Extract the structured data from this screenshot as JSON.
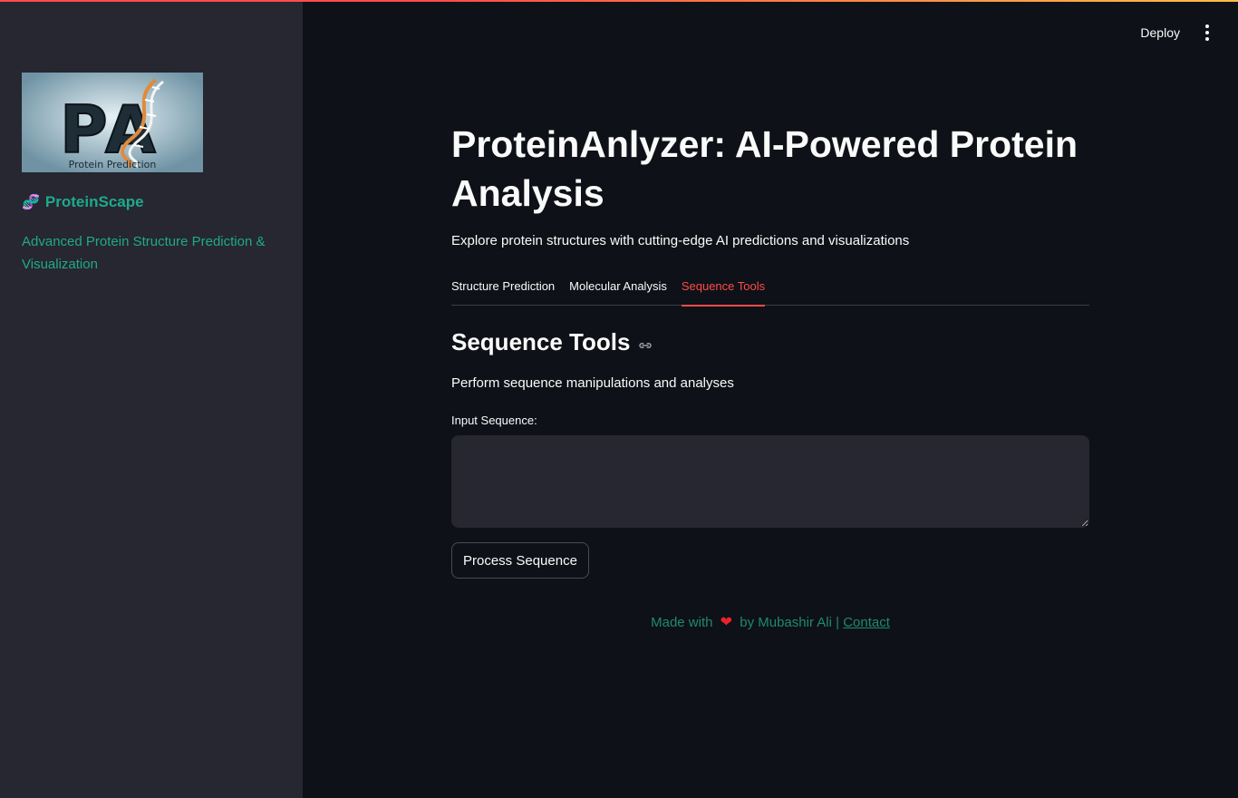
{
  "sidebar": {
    "logo": {
      "letters": "PA",
      "caption": "Protein Prediction"
    },
    "brand": {
      "icon": "dna-icon",
      "title": "ProteinScape"
    },
    "subtitle": "Advanced Protein Structure Prediction & Visualization"
  },
  "header": {
    "deploy_label": "Deploy",
    "menu_icon": "kebab-menu-icon"
  },
  "main": {
    "title": "ProteinAnlyzer: AI-Powered Protein Analysis",
    "description": "Explore protein structures with cutting-edge AI predictions and visualizations",
    "tabs": [
      {
        "label": "Structure Prediction",
        "active": false
      },
      {
        "label": "Molecular Analysis",
        "active": false
      },
      {
        "label": "Sequence Tools",
        "active": true
      }
    ],
    "section": {
      "title": "Sequence Tools",
      "description": "Perform sequence manipulations and analyses",
      "input_label": "Input Sequence:",
      "input_value": "",
      "button_label": "Process Sequence"
    },
    "footer": {
      "made_with": "Made with",
      "by": "by Mubashir Ali |",
      "contact": "Contact"
    }
  },
  "colors": {
    "background": "#0e1117",
    "sidebar": "#262730",
    "accent": "#ff4b4b",
    "brand_teal": "#1fa98c",
    "heart": "#e8232c"
  }
}
